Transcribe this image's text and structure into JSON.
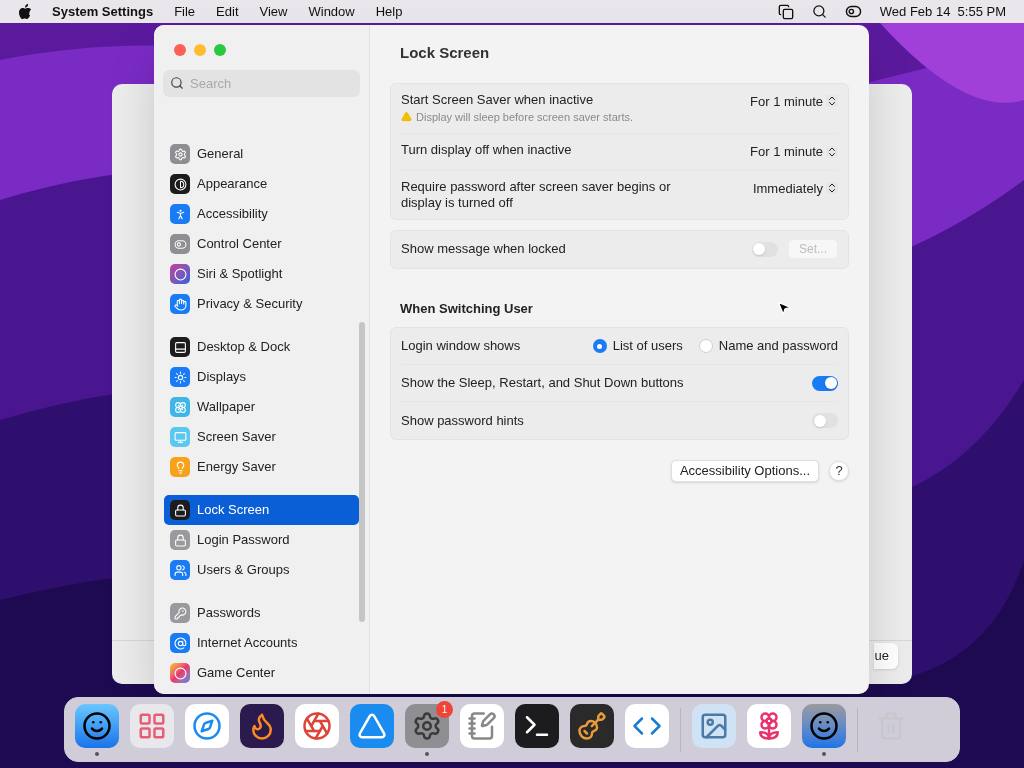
{
  "menu_bar": {
    "app": "System Settings",
    "menus": [
      "File",
      "Edit",
      "View",
      "Window",
      "Help"
    ],
    "clock": "Wed Feb 14  5:55 PM"
  },
  "background_window": {
    "button": "ue"
  },
  "sidebar": {
    "search": {
      "placeholder": "Search"
    },
    "groups": [
      [
        {
          "label": "General",
          "selected": false
        },
        {
          "label": "Appearance",
          "selected": false
        },
        {
          "label": "Accessibility",
          "selected": false
        },
        {
          "label": "Control Center",
          "selected": false
        },
        {
          "label": "Siri & Spotlight",
          "selected": false
        },
        {
          "label": "Privacy & Security",
          "selected": false
        }
      ],
      [
        {
          "label": "Desktop & Dock",
          "selected": false
        },
        {
          "label": "Displays",
          "selected": false
        },
        {
          "label": "Wallpaper",
          "selected": false
        },
        {
          "label": "Screen Saver",
          "selected": false
        },
        {
          "label": "Energy Saver",
          "selected": false
        }
      ],
      [
        {
          "label": "Lock Screen",
          "selected": true
        },
        {
          "label": "Login Password",
          "selected": false
        },
        {
          "label": "Users & Groups",
          "selected": false
        }
      ],
      [
        {
          "label": "Passwords",
          "selected": false
        },
        {
          "label": "Internet Accounts",
          "selected": false
        },
        {
          "label": "Game Center",
          "selected": false
        }
      ]
    ]
  },
  "content": {
    "title": "Lock Screen",
    "sections": [
      {
        "rows": [
          {
            "kind": "popup",
            "label": "Start Screen Saver when inactive",
            "note": "Display will sleep before screen saver starts.",
            "value": "For 1 minute"
          },
          {
            "kind": "popup",
            "label": "Turn display off when inactive",
            "value": "For 1 minute"
          },
          {
            "kind": "popup",
            "label": "Require password after screen saver begins or display is turned off",
            "value": "Immediately"
          }
        ]
      },
      {
        "rows": [
          {
            "kind": "toggle",
            "label": "Show message when locked",
            "on": false,
            "button": {
              "label": "Set...",
              "disabled": true
            }
          }
        ]
      },
      {
        "heading": "When Switching User",
        "rows": [
          {
            "kind": "radio",
            "label": "Login window shows",
            "options": [
              {
                "label": "List of users",
                "selected": true
              },
              {
                "label": "Name and password",
                "selected": false
              }
            ]
          },
          {
            "kind": "toggle",
            "label": "Show the Sleep, Restart, and Shut Down buttons",
            "on": true
          },
          {
            "kind": "toggle",
            "label": "Show password hints",
            "on": false
          }
        ]
      }
    ],
    "options_button": "Accessibility Options...",
    "help_button": "?"
  },
  "dock": [
    {
      "running": true
    },
    {
      "running": false
    },
    {
      "running": false
    },
    {
      "running": false
    },
    {
      "running": false
    },
    {
      "running": false
    },
    {
      "running": true,
      "badge": "1"
    },
    {
      "running": false
    },
    {
      "running": false
    },
    {
      "running": false
    },
    {
      "running": false
    },
    {
      "running": false
    },
    {
      "running": false
    },
    {
      "running": true
    },
    {
      "running": false
    }
  ]
}
